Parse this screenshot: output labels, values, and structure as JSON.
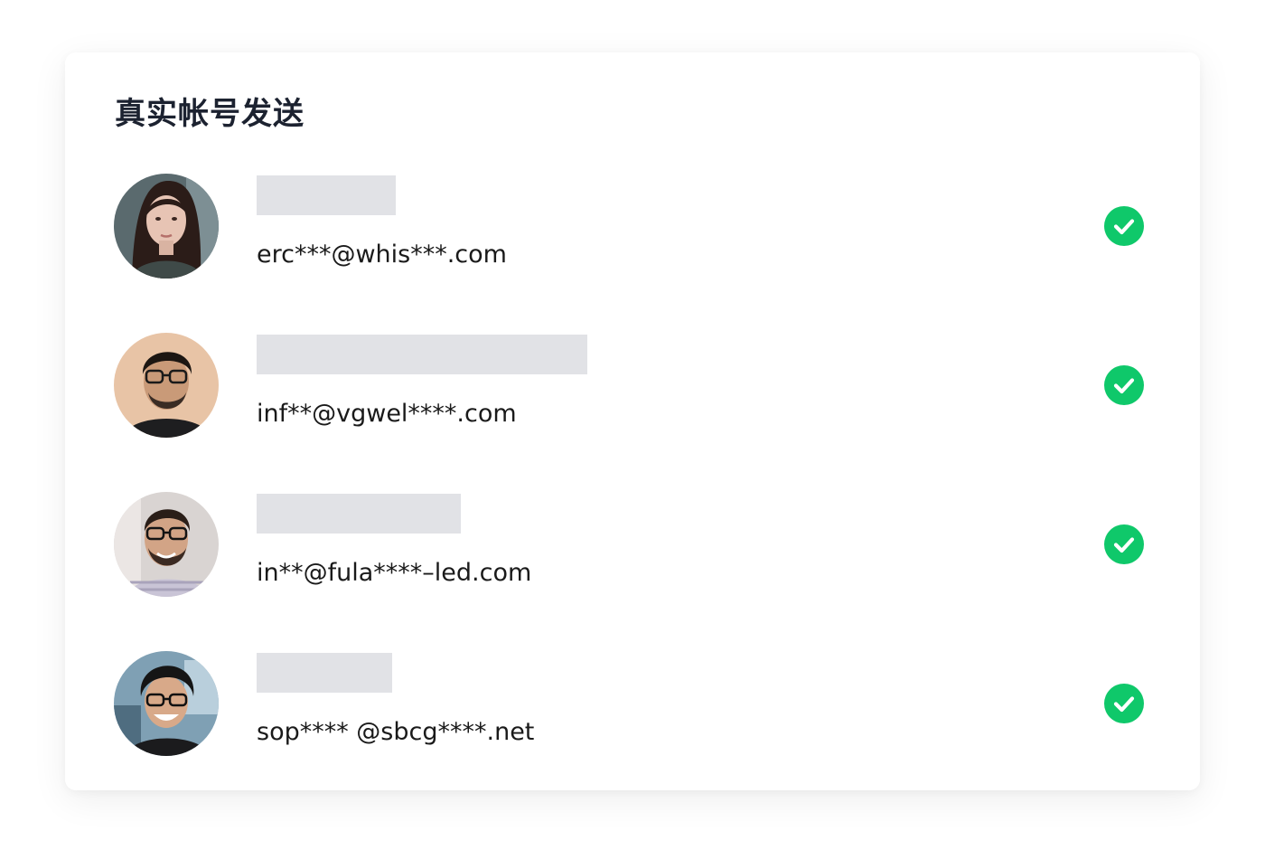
{
  "card": {
    "title": "真实帐号发送"
  },
  "accounts": [
    {
      "email": "erc***@whis***.com",
      "status_icon": "check-circle-icon",
      "status_color": "#0fc86a"
    },
    {
      "email": "inf**@vgwel****.com",
      "status_icon": "check-circle-icon",
      "status_color": "#0fc86a"
    },
    {
      "email": "in**@fula****–led.com",
      "status_icon": "check-circle-icon",
      "status_color": "#0fc86a"
    },
    {
      "email": "sop**** @sbcg****.net",
      "status_icon": "check-circle-icon",
      "status_color": "#0fc86a"
    }
  ],
  "colors": {
    "title": "#1c2230",
    "placeholder": "#e1e2e6",
    "success": "#0fc86a"
  }
}
